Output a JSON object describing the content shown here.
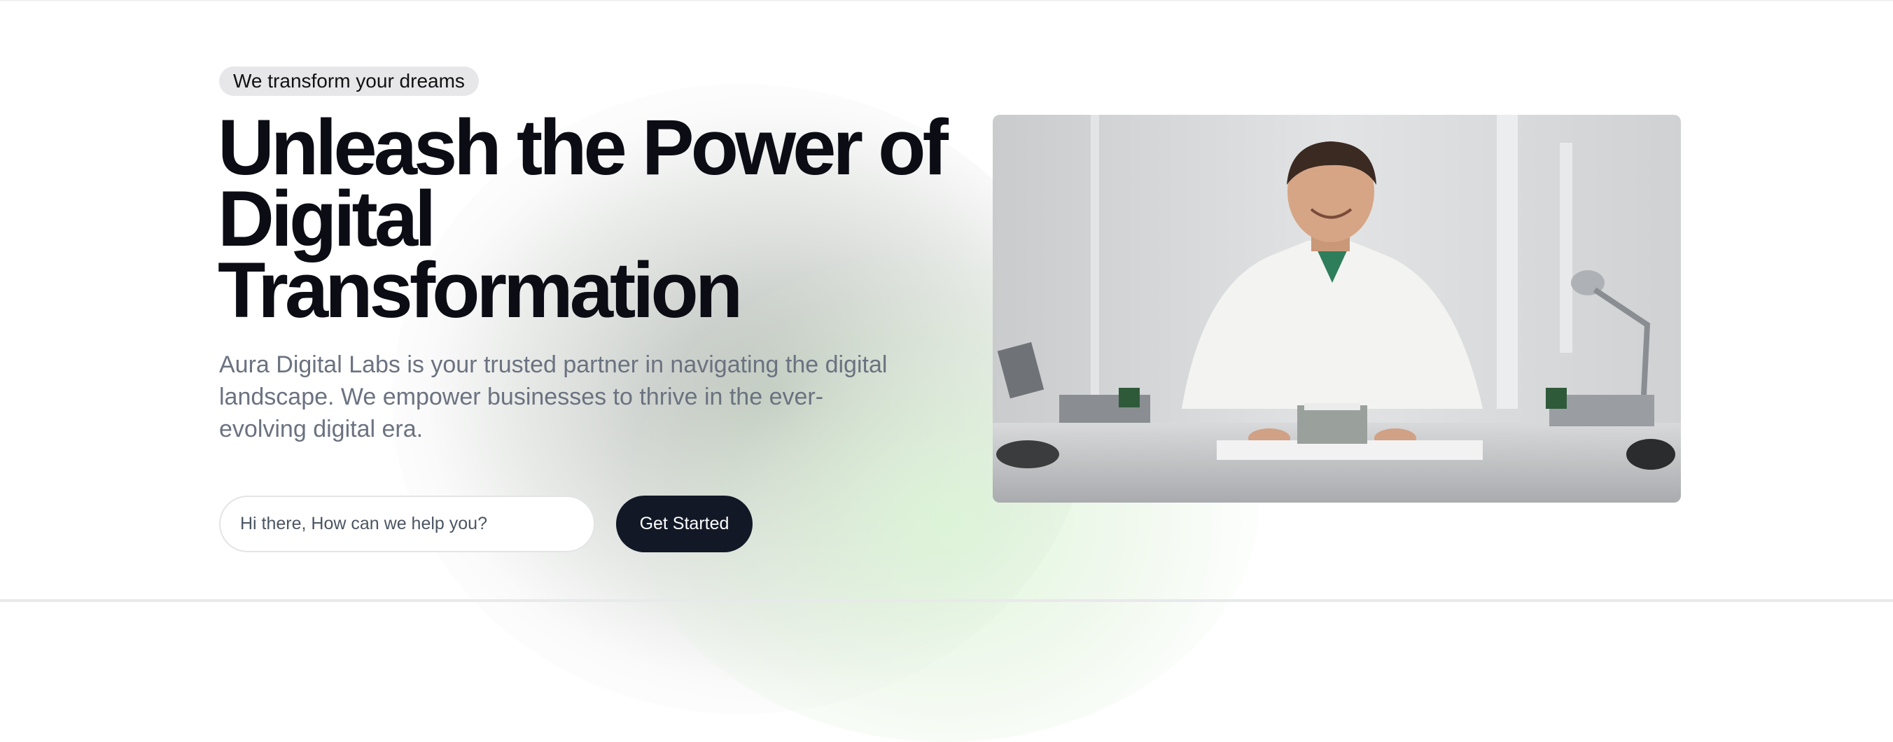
{
  "hero": {
    "badge": "We transform your dreams",
    "title_lines": [
      "Unleash the Power of",
      "Digital",
      "Transformation"
    ],
    "description": "Aura Digital Labs is your trusted partner in navigating the digital landscape. We empower businesses to thrive in the ever-evolving digital era.",
    "input_placeholder": "Hi there, How can we help you?",
    "cta_label": "Get Started"
  },
  "colors": {
    "cta_bg": "#121826",
    "title": "#0b0c14",
    "text_muted": "#6b7280",
    "badge_bg": "#e7e7ea"
  }
}
